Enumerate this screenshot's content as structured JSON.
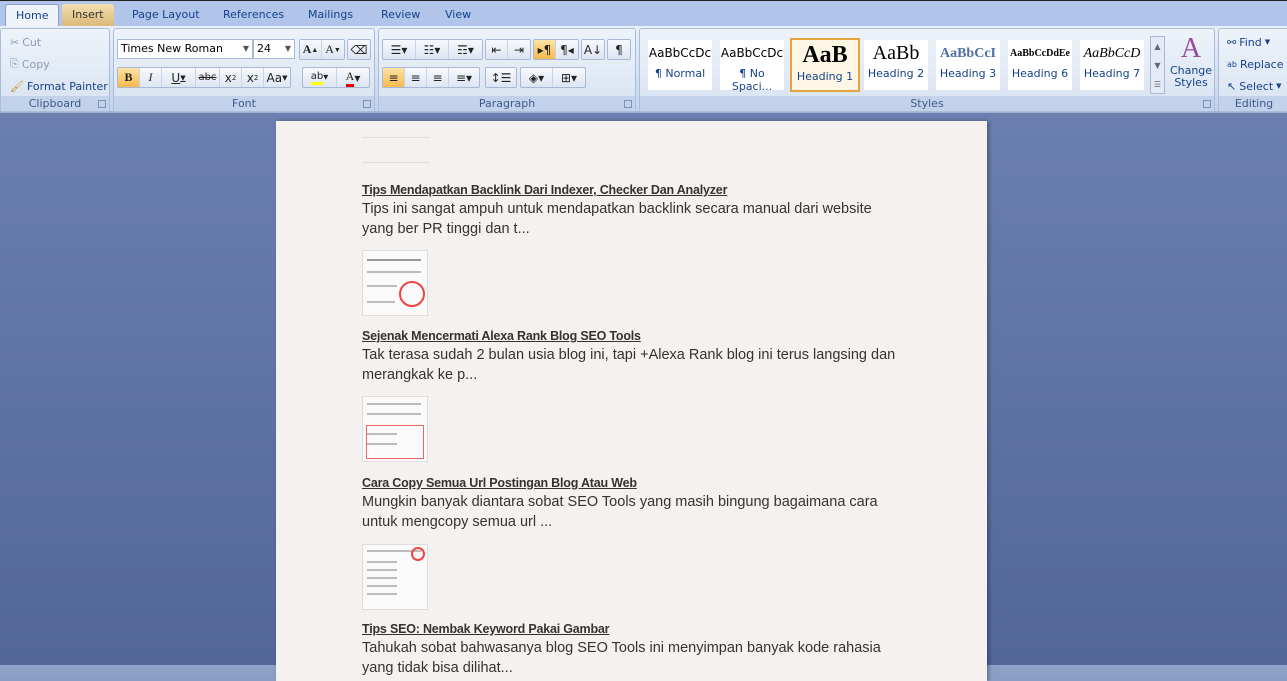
{
  "tabs": [
    "Home",
    "Insert",
    "Page Layout",
    "References",
    "Mailings",
    "Review",
    "View"
  ],
  "clipboard": {
    "label": "Clipboard",
    "cut": "Cut",
    "copy": "Copy",
    "format_painter": "Format Painter"
  },
  "font": {
    "label": "Font",
    "family": "Times New Roman",
    "size": "24"
  },
  "paragraph": {
    "label": "Paragraph"
  },
  "styles": {
    "label": "Styles",
    "items": [
      {
        "preview": "AaBbCcDc",
        "name": "¶ Normal"
      },
      {
        "preview": "AaBbCcDc",
        "name": "¶ No Spaci..."
      },
      {
        "preview": "AaB",
        "name": "Heading 1"
      },
      {
        "preview": "AaBb",
        "name": "Heading 2"
      },
      {
        "preview": "AaBbCcI",
        "name": "Heading 3"
      },
      {
        "preview": "AaBbCcDdEe",
        "name": "Heading 6"
      },
      {
        "preview": "AaBbCcD",
        "name": "Heading 7"
      }
    ],
    "change_styles": "Change Styles"
  },
  "editing": {
    "label": "Editing",
    "find": "Find",
    "replace": "Replace",
    "select": "Select"
  },
  "posts": [
    {
      "title": "Tips Mendapatkan Backlink Dari Indexer, Checker Dan Analyzer",
      "text": "Tips ini sangat ampuh untuk mendapatkan backlink secara manual dari website yang ber PR tinggi dan t..."
    },
    {
      "title": "Sejenak Mencermati  Alexa Rank Blog SEO Tools",
      "text": "Tak terasa sudah 2 bulan usia blog ini, tapi +Alexa Rank  blog ini terus langsing dan merangkak ke p..."
    },
    {
      "title": "Cara Copy Semua Url  Postingan Blog Atau Web",
      "text": "Mungkin banyak diantara sobat SEO Tools yang masih bingung bagaimana cara untuk mengcopy semua url ..."
    },
    {
      "title": "Tips SEO: Nembak Keyword  Pakai Gambar",
      "text": "Tahukah sobat bahwasanya blog SEO Tools ini menyimpan banyak kode rahasia yang tidak bisa dilihat..."
    }
  ]
}
